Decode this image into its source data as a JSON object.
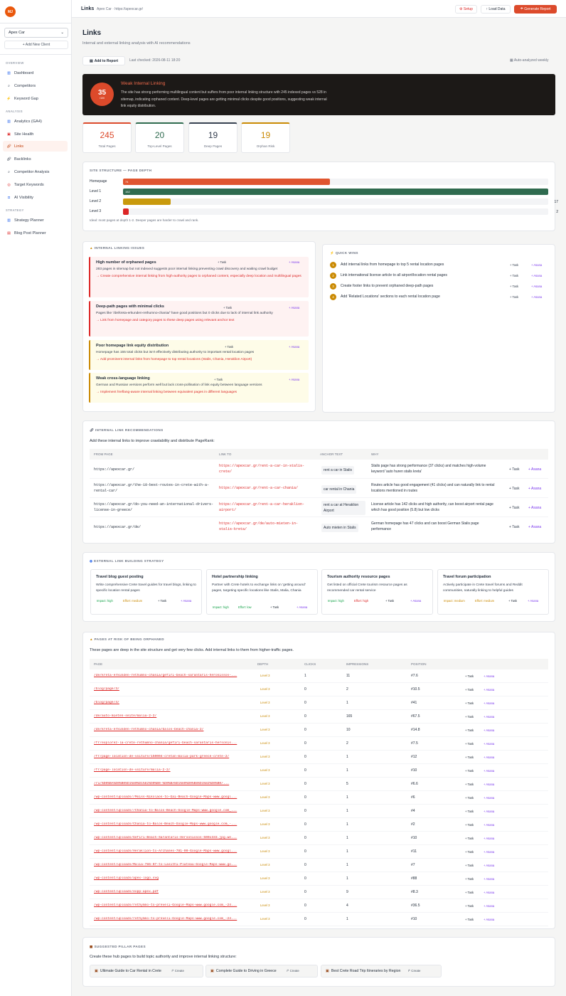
{
  "app": {
    "logo": "MJ",
    "client": "Apex Car",
    "add_client": "+ Add New Client"
  },
  "sidebar": {
    "sections": [
      {
        "label": "OVERVIEW"
      },
      {
        "label": "ANALYSIS"
      },
      {
        "label": "STRATEGY"
      }
    ],
    "items": [
      {
        "label": "Dashboard",
        "icon": "chart-icon"
      },
      {
        "label": "Competitors",
        "icon": "search-icon"
      },
      {
        "label": "Keyword Gap",
        "icon": "bolt-icon"
      },
      {
        "label": "Analytics (GA4)",
        "icon": "chart-icon"
      },
      {
        "label": "Site Health",
        "icon": "hospital-icon"
      },
      {
        "label": "Links",
        "icon": "link-icon"
      },
      {
        "label": "Backlinks",
        "icon": "link-icon"
      },
      {
        "label": "Competitor Analysis",
        "icon": "search-icon"
      },
      {
        "label": "Target Keywords",
        "icon": "target-icon"
      },
      {
        "label": "AI Visibility",
        "icon": "robot-icon"
      },
      {
        "label": "Strategy Planner",
        "icon": "chart-icon"
      },
      {
        "label": "Blog Post Planner",
        "icon": "calendar-icon"
      }
    ]
  },
  "header": {
    "title": "Links",
    "breadcrumb": "Apex Car · https://apexcar.gr/",
    "setup": "⚙ Setup",
    "load": "↑ Load Data",
    "generate": "☂ Generate Report"
  },
  "page": {
    "title": "Links",
    "subtitle": "Internal and external linking analysis with AI recommendations",
    "add_report": "Add to Report",
    "last_checked": "Last checked: 2026-08-11 18:20",
    "auto": "Auto-analyzed weekly"
  },
  "score": {
    "value": "35",
    "unit": "/100",
    "title": "Weak Internal Linking",
    "desc": "The site has strong performing multilingual content but suffers from poor internal linking structure with 245 indexed pages vs 528 in sitemap, indicating orphaned content. Deep-level pages are getting minimal clicks despite good positions, suggesting weak internal link equity distribution.",
    "color": "#dc4a2b"
  },
  "stats": [
    {
      "value": "245",
      "label": "Total Pages",
      "color": "#dc4a2b"
    },
    {
      "value": "20",
      "label": "Top-Level Pages",
      "color": "#2f6b4f"
    },
    {
      "value": "19",
      "label": "Deep Pages",
      "color": "#374151"
    },
    {
      "value": "19",
      "label": "Orphan Risk",
      "color": "#ca8a04"
    }
  ],
  "structure": {
    "label": "SITE STRUCTURE — PAGE DEPTH",
    "note": "Ideal: most pages at depth 1-2. Deeper pages are harder to crawl and rank.",
    "rows": [
      {
        "label": "Homepage",
        "value": 74,
        "shown": "74",
        "count": "",
        "color": "#e0552f"
      },
      {
        "label": "Level 1",
        "value": 152,
        "shown": "152",
        "count": "",
        "color": "#2f6b4f"
      },
      {
        "label": "Level 2",
        "value": 17,
        "shown": "",
        "count": "17",
        "color": "#c99a0d"
      },
      {
        "label": "Level 3",
        "value": 2,
        "shown": "",
        "count": "2",
        "color": "#dc2626"
      }
    ]
  },
  "issues": {
    "label": "INTERNAL LINKING ISSUES",
    "items": [
      {
        "title": "High number of orphaned pages",
        "desc": "283 pages in sitemap but not indexed suggests poor internal linking preventing crawl discovery and waiting crawl budget",
        "action": "→ Create comprehensive internal linking from high-authority pages to orphaned content, especially deep location and multilingual pages",
        "task": "+ Task",
        "asana": "+ Asana"
      },
      {
        "title": "Deep-path pages with minimal clicks",
        "desc": "Pages like '/de/kreta-erkunden-rethumno-chania/' have good positions but 0 clicks due to lack of internal link authority",
        "action": "→ Link from homepage and category pages to these deep pages using relevant anchor text",
        "task": "+ Task",
        "asana": "+ Asana"
      },
      {
        "title": "Poor homepage link equity distribution",
        "desc": "Homepage has 155 total clicks but isn't effectively distributing authority to important rental location pages",
        "action": "→ Add prominent internal links from homepage to top rental locations (Stalis, Chania, Heraklion Airport)",
        "task": "+ Task",
        "asana": "+ Asana"
      },
      {
        "title": "Weak cross-language linking",
        "desc": "German and Russian versions perform well but lack cross-pollination of link equity between language versions",
        "action": "→ Implement hreflang-aware internal linking between equivalent pages in different languages",
        "task": "+ Task",
        "asana": "+ Asana"
      }
    ]
  },
  "quick_wins": {
    "label": "QUICK WINS",
    "items": [
      {
        "n": "1",
        "text": "Add internal links from homepage to top 5 rental location pages",
        "task": "+ Task",
        "asana": "+ Asana"
      },
      {
        "n": "2",
        "text": "Link international license article to all airport/location rental pages",
        "task": "+ Task",
        "asana": "+ Asana"
      },
      {
        "n": "3",
        "text": "Create footer links to prevent orphaned deep-path pages",
        "task": "+ Task",
        "asana": "+ Asana"
      },
      {
        "n": "4",
        "text": "Add 'Related Locations' sections to each rental location page",
        "task": "+ Task",
        "asana": "+ Asana"
      }
    ]
  },
  "recs": {
    "label": "INTERNAL LINK RECOMMENDATIONS",
    "intro": "Add these internal links to improve crawlability and distribute PageRank:",
    "headers": [
      "FROM PAGE",
      "LINK TO",
      "ANCHOR TEXT",
      "WHY"
    ],
    "rows": [
      {
        "from": "https://apexcar.gr/",
        "to": "https://apexcar.gr/rent-a-car-in-stalis-crete/",
        "anchor": "rent a car in Stalis",
        "why": "Stalis page has strong performance (37 clicks) and matches high-volume keyword 'auto huren stalis kreta'",
        "task": "+ Task",
        "asana": "+ Asana"
      },
      {
        "from": "https://apexcar.gr/the-10-best-routes-in-crete-with-a-rental-car/",
        "to": "https://apexcar.gr/rent-a-car-chania/",
        "anchor": "car rental in Chania",
        "why": "Routes article has good engagement (41 clicks) and can naturally link to rental locations mentioned in routes",
        "task": "+ Task",
        "asana": "+ Asana"
      },
      {
        "from": "https://apexcar.gr/do-you-need-an-international-drivers-license-in-greece/",
        "to": "https://apexcar.gr/rent-a-car-heraklion-airport/",
        "anchor": "rent a car at Heraklion Airport",
        "why": "License article has 142 clicks and high authority, can boost airport rental page which has good position (5.8) but low clicks",
        "task": "+ Task",
        "asana": "+ Asana"
      },
      {
        "from": "https://apexcar.gr/de/",
        "to": "https://apexcar.gr/de/auto-mieten-in-stalis-kreta/",
        "anchor": "Auto mieten in Stalis",
        "why": "German homepage has 47 clicks and can boost German Stalis page performance",
        "task": "+ Task",
        "asana": "+ Asana"
      }
    ]
  },
  "external": {
    "label": "EXTERNAL LINK BUILDING STRATEGY",
    "items": [
      {
        "title": "Travel blog guest posting",
        "desc": "Write comprehensive Crete travel guides for travel blogs, linking to specific location rental pages",
        "impact": "Impact: high",
        "effort": "Effort: medium",
        "task": "+ Task",
        "asana": "+ Asana"
      },
      {
        "title": "Hotel partnership linking",
        "desc": "Partner with Crete hotels to exchange links on 'getting around' pages, targeting specific locations like Stalis, Malia, Chania",
        "impact": "Impact: high",
        "effort": "Effort: low",
        "task": "+ Task",
        "asana": "+ Asana"
      },
      {
        "title": "Tourism authority resource pages",
        "desc": "Get listed on official Crete tourism resource pages as recommended car rental service",
        "impact": "Impact: high",
        "effort": "Effort: high",
        "task": "+ Task",
        "asana": "+ Asana"
      },
      {
        "title": "Travel forum participation",
        "desc": "Actively participate in Crete travel forums and Reddit communities, naturally linking to helpful guides",
        "impact": "Impact: medium",
        "effort": "Effort: medium",
        "task": "+ Task",
        "asana": "+ Asana"
      }
    ]
  },
  "orphans": {
    "label": "PAGES AT RISK OF BEING ORPHANED",
    "intro": "These pages are deep in the site structure and get very few clicks. Add internal links to them from higher-traffic pages.",
    "headers": [
      "PAGE",
      "DEPTH",
      "CLICKS",
      "IMPRESSIONS",
      "POSITION"
    ],
    "rows": [
      {
        "page": "/de/kreta-erkunden-rethumno-chania/gefiri-beach-sarantaris-heronissos-...",
        "depth": "Level 3",
        "clicks": "1",
        "impr": "11",
        "pos": "#7.6"
      },
      {
        "page": "/blog/page/3/",
        "depth": "Level 3",
        "clicks": "0",
        "impr": "2",
        "pos": "#10.5"
      },
      {
        "page": "/blog/page/4/",
        "depth": "Level 3",
        "clicks": "0",
        "impr": "1",
        "pos": "#41"
      },
      {
        "page": "/de/auto-mieten-seite/malia-2-2/",
        "depth": "Level 3",
        "clicks": "0",
        "impr": "165",
        "pos": "#67.5"
      },
      {
        "page": "/de/kreta-erkunden-rethumno-chania/balos-beach-chania-2/",
        "depth": "Level 3",
        "clicks": "0",
        "impr": "10",
        "pos": "#14.8"
      },
      {
        "page": "/fr/explorez-la-crete-rethumno-chania/gefiri-beach-sarantaris-hersonis...",
        "depth": "Level 3",
        "clicks": "0",
        "impr": "2",
        "pos": "#7.5"
      },
      {
        "page": "/fr/page-location-de-voiture/150004-cretan-malia-park-greece-crete-2/",
        "depth": "Level 3",
        "clicks": "0",
        "impr": "1",
        "pos": "#12"
      },
      {
        "page": "/fr/page-location-de-voiture/malia-2-2/",
        "depth": "Level 3",
        "clicks": "0",
        "impr": "1",
        "pos": "#10"
      },
      {
        "page": "/ru/%D0%BA%D0%B0%D1%80%D1%82%D0%B0-%D0%BA%D1%80%D0%B8%D1%82%D0%B0/...",
        "depth": "Level 3",
        "clicks": "0",
        "impr": "5",
        "pos": "#6.6"
      },
      {
        "page": "/wp-content/uploads//Moiss-Nikolaos-to-Gai-Beach-Google-Maps-www.googl...",
        "depth": "Level 3",
        "clicks": "0",
        "impr": "1",
        "pos": "#6"
      },
      {
        "page": "/wp-content/uploads//Chania-to-Balos-Beach-Google-Maps-www.google.com_...",
        "depth": "Level 3",
        "clicks": "0",
        "impr": "1",
        "pos": "#4"
      },
      {
        "page": "/wp-content/uploads/Chania-to-Balos-Beach-Google-Maps-www.google.com_-...",
        "depth": "Level 3",
        "clicks": "0",
        "impr": "1",
        "pos": "#2"
      },
      {
        "page": "/wp-content/uploads/Gefiri-Beach-Sarantaris-Hersonissos-500x333.jpg.we...",
        "depth": "Level 3",
        "clicks": "0",
        "impr": "1",
        "pos": "#10"
      },
      {
        "page": "/wp-content/uploads/Heraklion-to-Archanes-781-00-Google-Maps-www.googl...",
        "depth": "Level 3",
        "clicks": "0",
        "impr": "1",
        "pos": "#11"
      },
      {
        "page": "/wp-content/uploads/Malia-786-07-to-Lasithi-Plateau-Google-Maps-www.go...",
        "depth": "Level 3",
        "clicks": "0",
        "impr": "1",
        "pos": "#7"
      },
      {
        "page": "/wp-content/uploads/apex-logo.svg",
        "depth": "Level 3",
        "clicks": "0",
        "impr": "1",
        "pos": "#88"
      },
      {
        "page": "/wp-content/uploads/eopp-apex.pdf",
        "depth": "Level 3",
        "clicks": "0",
        "impr": "9",
        "pos": "#8.3"
      },
      {
        "page": "/wp-content/uploads/rethymno-to-preveli-Google-Maps-www.google.com_-24...",
        "depth": "Level 3",
        "clicks": "0",
        "impr": "4",
        "pos": "#36.5"
      },
      {
        "page": "/wp-content/uploads/rethymno-to-preveli-Google-Maps-www.google.com_-24...",
        "depth": "Level 3",
        "clicks": "0",
        "impr": "1",
        "pos": "#10"
      }
    ],
    "task": "+ Task",
    "asana": "+ Asana"
  },
  "pillars": {
    "label": "SUGGESTED PILLAR PAGES",
    "intro": "Create these hub pages to build topic authority and improve internal linking structure:",
    "items": [
      {
        "title": "Ultimate Guide to Car Rental in Crete",
        "create": "Create"
      },
      {
        "title": "Complete Guide to Driving in Greece",
        "create": "Create"
      },
      {
        "title": "Best Crete Road Trip Itineraries by Region",
        "create": "Create"
      }
    ]
  }
}
